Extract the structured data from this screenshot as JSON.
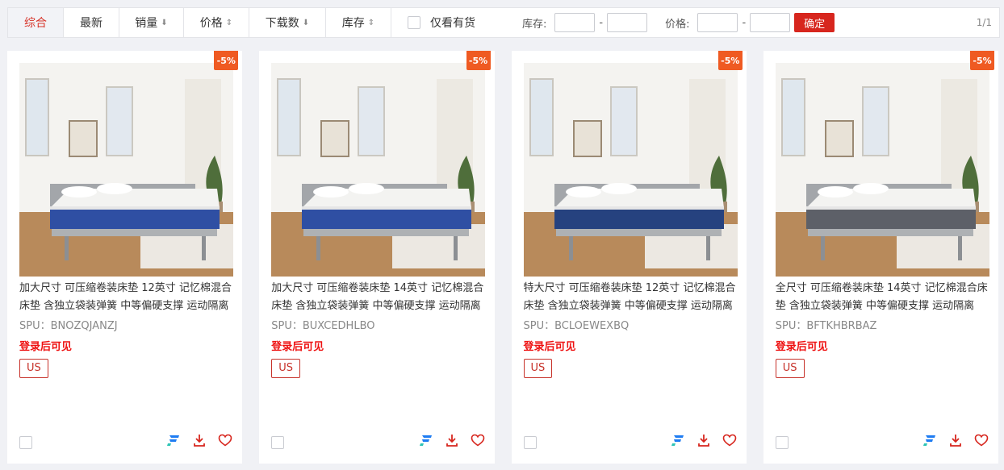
{
  "toolbar": {
    "tabs": [
      {
        "label": "综合",
        "arrow": "",
        "active": true
      },
      {
        "label": "最新",
        "arrow": ""
      },
      {
        "label": "销量",
        "arrow": "⬇"
      },
      {
        "label": "价格",
        "arrow": "⇕"
      },
      {
        "label": "下载数",
        "arrow": "⬇"
      },
      {
        "label": "库存",
        "arrow": "⇕"
      }
    ],
    "stock_only_label": "仅看有货",
    "stock_label": "库存:",
    "price_label": "价格:",
    "range_dash": "-",
    "confirm_label": "确定",
    "pager": "1/1"
  },
  "products": [
    {
      "discount": "-5%",
      "title": "加大尺寸 可压缩卷装床垫 12英寸 记忆棉混合床垫 含独立袋装弹簧 中等偏硬支撑 运动隔离",
      "spu": "SPU：BNOZQJANZJ",
      "login_text": "登录后可见",
      "tag": "US",
      "mattress_color": "#2f4fa3"
    },
    {
      "discount": "-5%",
      "title": "加大尺寸 可压缩卷装床垫 14英寸 记忆棉混合床垫 含独立袋装弹簧 中等偏硬支撑 运动隔离",
      "spu": "SPU：BUXCEDHLBO",
      "login_text": "登录后可见",
      "tag": "US",
      "mattress_color": "#2f4fa3"
    },
    {
      "discount": "-5%",
      "title": "特大尺寸 可压缩卷装床垫 12英寸 记忆棉混合床垫 含独立袋装弹簧 中等偏硬支撑 运动隔离",
      "spu": "SPU：BCLOEWEXBQ",
      "login_text": "登录后可见",
      "tag": "US",
      "mattress_color": "#26427f"
    },
    {
      "discount": "-5%",
      "title": "全尺寸 可压缩卷装床垫 14英寸 记忆棉混合床垫 含独立袋装弹簧 中等偏硬支撑 运动隔离",
      "spu": "SPU：BFTKHBRBAZ",
      "login_text": "登录后可见",
      "tag": "US",
      "mattress_color": "#5d6068"
    }
  ],
  "colors": {
    "accent": "#d7261e",
    "discount": "#ef5a22",
    "brand_icon": "#1e7cf2"
  }
}
